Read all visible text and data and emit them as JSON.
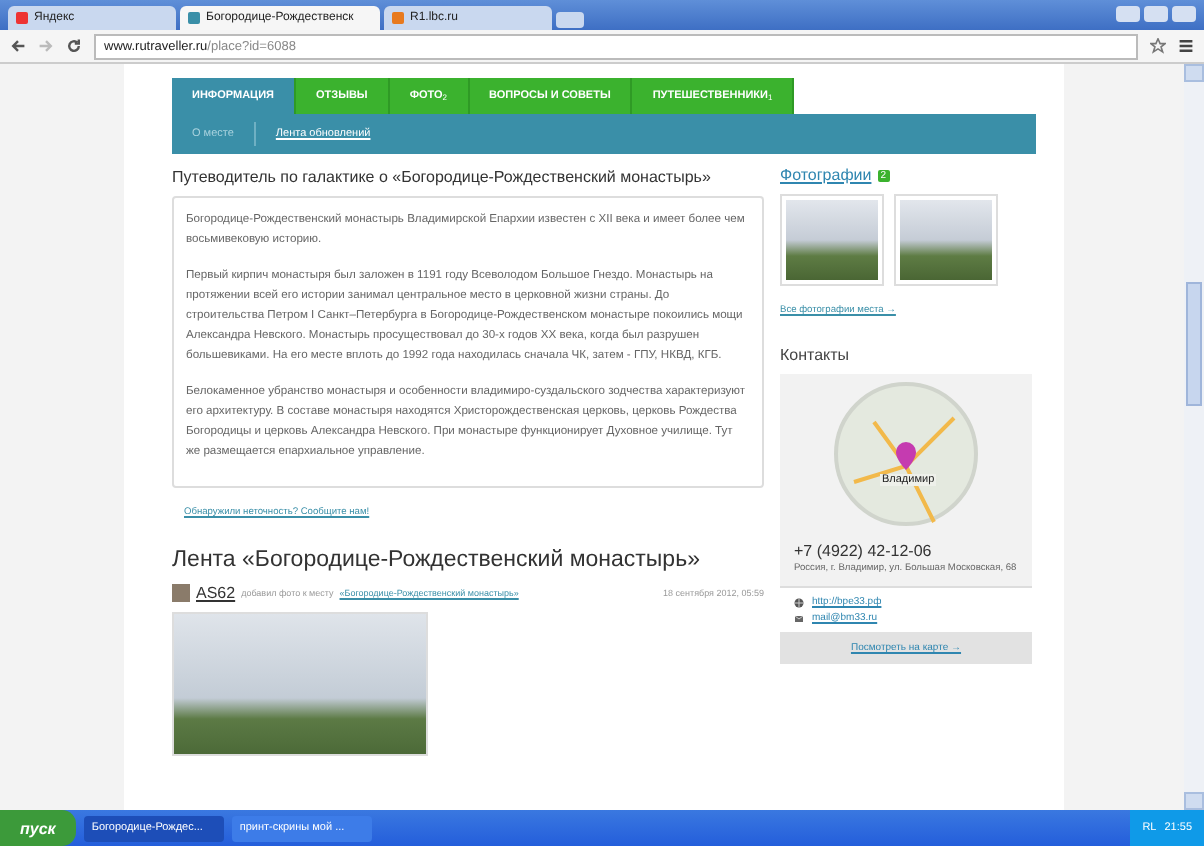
{
  "browser": {
    "tabs": [
      {
        "title": "Яндекс",
        "selected": false
      },
      {
        "title": "Богородице-Рождественск",
        "selected": true
      },
      {
        "title": "R1.lbc.ru",
        "selected": false
      }
    ],
    "address": {
      "host": "www.rutraveller.ru",
      "path": "/place?id=6088"
    }
  },
  "nav": {
    "tabs": [
      {
        "label": "ИНФОРМАЦИЯ",
        "selected": true
      },
      {
        "label": "ОТЗЫВЫ",
        "selected": false
      },
      {
        "label": "ФОТО",
        "count": "2",
        "selected": false
      },
      {
        "label": "ВОПРОСЫ И СОВЕТЫ",
        "selected": false
      },
      {
        "label": "ПУТЕШЕСТВЕННИКИ",
        "count": "1",
        "selected": false
      }
    ],
    "subnav": [
      {
        "label": "О месте",
        "selected": true
      },
      {
        "label": "Лента обновлений",
        "selected": false
      }
    ]
  },
  "guide": {
    "title": "Путеводитель по галактике о «Богородице-Рождественский монастырь»",
    "paragraphs": [
      "Богородице-Рождественский монастырь Владимирской Епархии известен с XII века и имеет более чем восьмивековую историю.",
      "Первый кирпич монастыря был заложен в 1191 году Всеволодом Большое Гнездо. Монастырь на протяжении всей его истории занимал центральное место в церковной жизни страны. До строительства Петром I Санкт–Петербурга в Богородице-Рождественском монастыре покоились мощи Александра Невского. Монастырь просуществовал до 30-х годов XX века, когда был разрушен большевиками. На его месте вплоть до 1992 года находилась сначала ЧК, затем - ГПУ, НКВД, КГБ.",
      "Белокаменное убранство монастыря и особенности владимиро-суздальского зодчества характеризуют его архитектуру. В составе монастыря находятся Христорождественская церковь, церковь Рождества Богородицы и церковь Александра Невского. При монастыре функционирует Духовное училище. Тут же размещается епархиальное управление."
    ],
    "report_link": "Обнаружили неточность? Сообщите нам!"
  },
  "feed": {
    "title": "Лента «Богородице-Рождественский монастырь»",
    "post": {
      "user": "AS62",
      "action": "добавил фото к месту",
      "place": "«Богородице-Рождественский монастырь»",
      "date": "18 сентября 2012, 05:59"
    }
  },
  "sidebar": {
    "photos_title": "Фотографии",
    "photos_count": "2",
    "all_photos": "Все фотографии места →",
    "contacts_title": "Контакты",
    "map_label": "Владимир",
    "phone": "+7 (4922) 42-12-06",
    "address": "Россия, г. Владимир, ул. Большая Московская, 68",
    "links": [
      {
        "kind": "web",
        "text": "http://bpe33.рф"
      },
      {
        "kind": "mail",
        "text": "mail@bm33.ru"
      }
    ],
    "map_link": "Посмотреть на карте →"
  },
  "taskbar": {
    "start": "пуск",
    "windows": [
      {
        "title": "Богородице-Рождес...",
        "selected": true
      },
      {
        "title": "принт-скрины мой ...",
        "selected": false
      }
    ],
    "tray_lang": "RL",
    "clock": "21:55"
  }
}
